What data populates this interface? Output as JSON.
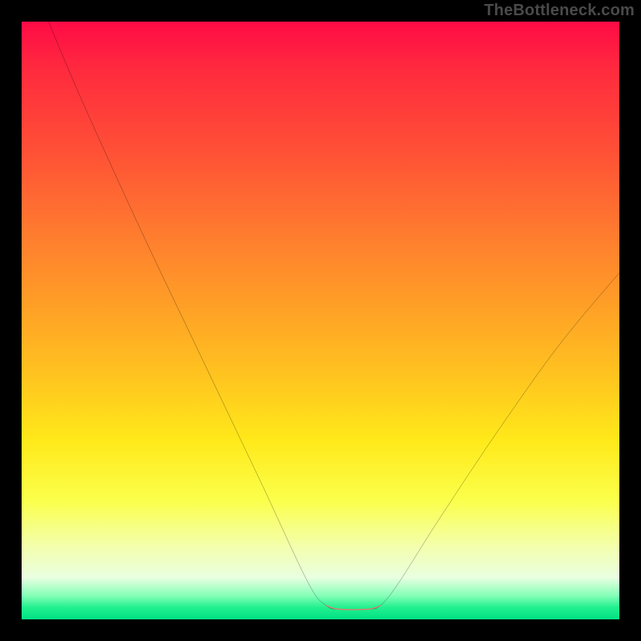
{
  "watermark": "TheBottleneck.com",
  "chart_data": {
    "type": "line",
    "title": "",
    "xlabel": "",
    "ylabel": "",
    "xlim": [
      0,
      100
    ],
    "ylim": [
      0,
      100
    ],
    "gradient_stops": [
      {
        "pos": 0,
        "color": "#ff0b46"
      },
      {
        "pos": 8,
        "color": "#ff2a3e"
      },
      {
        "pos": 22,
        "color": "#ff5136"
      },
      {
        "pos": 35,
        "color": "#ff7a2f"
      },
      {
        "pos": 48,
        "color": "#ffa126"
      },
      {
        "pos": 60,
        "color": "#ffc61f"
      },
      {
        "pos": 70,
        "color": "#ffe91a"
      },
      {
        "pos": 80,
        "color": "#fbff4a"
      },
      {
        "pos": 88,
        "color": "#f3ffaf"
      },
      {
        "pos": 93,
        "color": "#e9ffe0"
      },
      {
        "pos": 96,
        "color": "#86ffb8"
      },
      {
        "pos": 98,
        "color": "#22f08f"
      },
      {
        "pos": 100,
        "color": "#00e184"
      }
    ],
    "series": [
      {
        "name": "curve",
        "color": "#000000",
        "points": [
          {
            "x": 4.5,
            "y": 100
          },
          {
            "x": 10,
            "y": 87
          },
          {
            "x": 20,
            "y": 65
          },
          {
            "x": 30,
            "y": 44
          },
          {
            "x": 40,
            "y": 23
          },
          {
            "x": 48,
            "y": 6
          },
          {
            "x": 51,
            "y": 2.3
          },
          {
            "x": 53,
            "y": 1.7
          },
          {
            "x": 58,
            "y": 1.7
          },
          {
            "x": 60,
            "y": 2.3
          },
          {
            "x": 63,
            "y": 6
          },
          {
            "x": 70,
            "y": 17
          },
          {
            "x": 80,
            "y": 32
          },
          {
            "x": 90,
            "y": 46
          },
          {
            "x": 100,
            "y": 58
          }
        ]
      },
      {
        "name": "highlight-segment",
        "color": "#e2786d",
        "points": [
          {
            "x": 51,
            "y": 2.3
          },
          {
            "x": 53,
            "y": 1.7
          },
          {
            "x": 58,
            "y": 1.7
          },
          {
            "x": 60,
            "y": 2.3
          }
        ]
      }
    ]
  }
}
